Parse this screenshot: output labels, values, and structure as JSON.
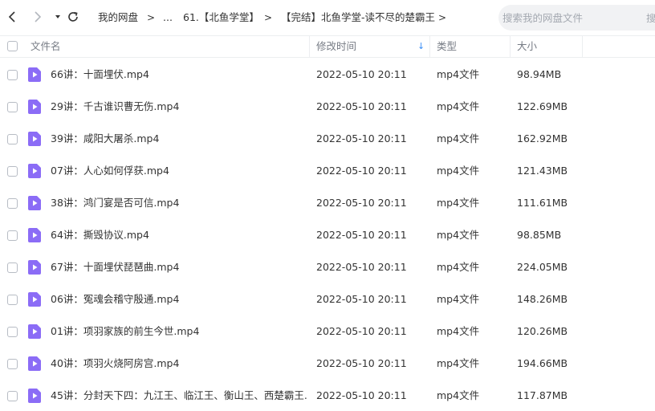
{
  "nav": {
    "breadcrumbs": [
      {
        "label": "我的网盘"
      },
      {
        "label": "..."
      },
      {
        "label": "61.【北鱼学堂】"
      },
      {
        "label": "【完结】北鱼学堂-读不尽的楚霸王"
      }
    ],
    "separator": ">"
  },
  "search": {
    "placeholder": "搜索我的网盘文件",
    "tail": "搜"
  },
  "header": {
    "name": "文件名",
    "modified": "修改时间",
    "type": "类型",
    "size": "大小",
    "sort_indicator": "↓"
  },
  "colors": {
    "accent": "#3a8ef6",
    "file_icon": "#8b6cf6"
  },
  "files": [
    {
      "name": "66讲：十面埋伏.mp4",
      "modified": "2022-05-10 20:11",
      "type": "mp4文件",
      "size": "98.94MB"
    },
    {
      "name": "29讲：千古谁识曹无伤.mp4",
      "modified": "2022-05-10 20:11",
      "type": "mp4文件",
      "size": "122.69MB"
    },
    {
      "name": "39讲：咸阳大屠杀.mp4",
      "modified": "2022-05-10 20:11",
      "type": "mp4文件",
      "size": "162.92MB"
    },
    {
      "name": "07讲：人心如何俘获.mp4",
      "modified": "2022-05-10 20:11",
      "type": "mp4文件",
      "size": "121.43MB"
    },
    {
      "name": "38讲：鸿门宴是否可信.mp4",
      "modified": "2022-05-10 20:11",
      "type": "mp4文件",
      "size": "111.61MB"
    },
    {
      "name": "64讲：撕毁协议.mp4",
      "modified": "2022-05-10 20:11",
      "type": "mp4文件",
      "size": "98.85MB"
    },
    {
      "name": "67讲：十面埋伏琵琶曲.mp4",
      "modified": "2022-05-10 20:11",
      "type": "mp4文件",
      "size": "224.05MB"
    },
    {
      "name": "06讲：冤魂会稽守殷通.mp4",
      "modified": "2022-05-10 20:11",
      "type": "mp4文件",
      "size": "148.26MB"
    },
    {
      "name": "01讲：项羽家族的前生今世.mp4",
      "modified": "2022-05-10 20:11",
      "type": "mp4文件",
      "size": "120.26MB"
    },
    {
      "name": "40讲：项羽火烧阿房宫.mp4",
      "modified": "2022-05-10 20:11",
      "type": "mp4文件",
      "size": "194.66MB"
    },
    {
      "name": "45讲：分封天下四：九江王、临江王、衡山王、西楚霸王...",
      "modified": "2022-05-10 20:11",
      "type": "mp4文件",
      "size": "117.87MB"
    }
  ]
}
